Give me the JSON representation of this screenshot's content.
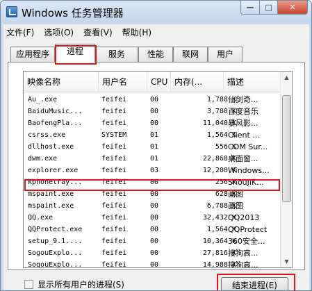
{
  "window": {
    "title": "Windows 任务管理器",
    "min_label": "—",
    "max_label": "□",
    "close_label": "✕"
  },
  "menu": {
    "items": [
      "文件(F)",
      "选项(O)",
      "查看(V)",
      "帮助(H)"
    ]
  },
  "tabs": [
    "应用程序",
    "进程",
    "服务",
    "性能",
    "联网",
    "用户"
  ],
  "active_tab": "进程",
  "table": {
    "columns": [
      "映像名称",
      "用户名",
      "CPU",
      "内存(...",
      "描述"
    ],
    "rows": [
      [
        "Au_.exe",
        "feifei",
        "00",
        "1,788 K",
        "仙剑奇..."
      ],
      [
        "BaiduMusic...",
        "feifei",
        "00",
        "3,780 K",
        "百度音乐"
      ],
      [
        "BaofengPla...",
        "feifei",
        "00",
        "11,040 K",
        "暴风影..."
      ],
      [
        "csrss.exe",
        "SYSTEM",
        "01",
        "1,564 K",
        "Client ..."
      ],
      [
        "dllhost.exe",
        "feifei",
        "01",
        "556 K",
        "COM Sur..."
      ],
      [
        "dwm.exe",
        "feifei",
        "01",
        "22,868 K",
        "桌面窗..."
      ],
      [
        "explorer.exe",
        "feifei",
        "03",
        "12,200 K",
        "Windows..."
      ],
      [
        "kphonetray...",
        "feifei",
        "00",
        "256 K",
        "ShouJiK..."
      ],
      [
        "mspaint.exe",
        "feifei",
        "00",
        "628 K",
        "画图"
      ],
      [
        "mspaint.exe",
        "feifei",
        "00",
        "6,788 K",
        "画图"
      ],
      [
        "QQ.exe",
        "feifei",
        "00",
        "32,432 K",
        "QQ2013"
      ],
      [
        "QQProtect.exe",
        "feifei",
        "00",
        "1,564 K",
        "QQProtect"
      ],
      [
        "setup_9.1....",
        "feifei",
        "00",
        "10,364 K",
        "360安全..."
      ],
      [
        "SogouExplo...",
        "feifei",
        "00",
        "27,816 K",
        "搜狗高..."
      ],
      [
        "SogouExplo...",
        "feifei",
        "00",
        "14,988 K",
        "搜狗高..."
      ]
    ],
    "selected_row": "kphonetray..."
  },
  "scrollbar": {
    "up_icon": "▲",
    "down_icon": "▼",
    "thumb_start_fraction": 0.07,
    "thumb_size_fraction": 0.62
  },
  "footer": {
    "show_all_label": "显示所有用户的进程(S)",
    "end_process_label": "结束进程(E)"
  },
  "highlight_color": "#e0141c"
}
